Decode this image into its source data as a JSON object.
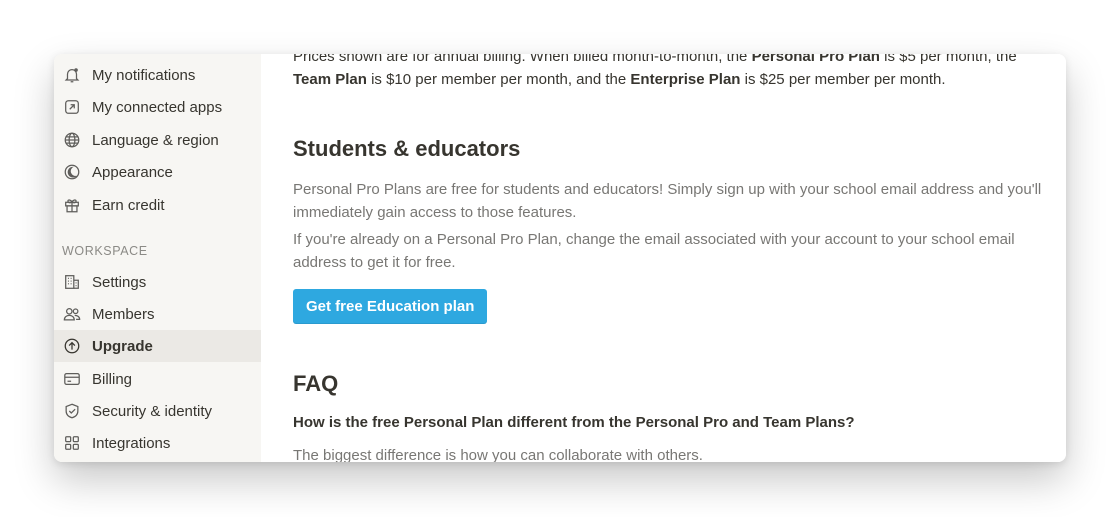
{
  "sidebar": {
    "account_items": [
      {
        "label": "My notifications",
        "icon": "bell-icon"
      },
      {
        "label": "My connected apps",
        "icon": "arrow-up-right-box-icon"
      },
      {
        "label": "Language & region",
        "icon": "globe-icon"
      },
      {
        "label": "Appearance",
        "icon": "half-moon-icon"
      },
      {
        "label": "Earn credit",
        "icon": "gift-icon"
      }
    ],
    "workspace_header": "WORKSPACE",
    "workspace_items": [
      {
        "label": "Settings",
        "icon": "building-icon"
      },
      {
        "label": "Members",
        "icon": "people-icon"
      },
      {
        "label": "Upgrade",
        "icon": "arrow-up-circle-icon",
        "active": true
      },
      {
        "label": "Billing",
        "icon": "credit-card-icon"
      },
      {
        "label": "Security & identity",
        "icon": "shield-check-icon"
      },
      {
        "label": "Integrations",
        "icon": "grid-icon"
      }
    ]
  },
  "main": {
    "pricing_note": {
      "t1": "Prices shown are for annual billing. When billed month-to-month, the ",
      "b1": "Personal Pro Plan",
      "t2": " is $5 per month, the ",
      "b2": "Team Plan",
      "t3": " is $10 per member per month, and the ",
      "b3": "Enterprise Plan",
      "t4": " is $25 per member per month."
    },
    "students_heading": "Students & educators",
    "students_p1": "Personal Pro Plans are free for students and educators! Simply sign up with your school email address and you'll immediately gain access to those features.",
    "students_p2": "If you're already on a Personal Pro Plan, change the email associated with your account to your school email address to get it for free.",
    "education_button": "Get free Education plan",
    "faq_heading": "FAQ",
    "faq_question": "How is the free Personal Plan different from the Personal Pro and Team Plans?",
    "faq_answer": "The biggest difference is how you can collaborate with others."
  },
  "colors": {
    "sidebar_bg": "#f7f6f3",
    "active_bg": "#ebe9e5",
    "accent": "#2ea8e0",
    "text": "#37352f",
    "muted": "#787774"
  }
}
